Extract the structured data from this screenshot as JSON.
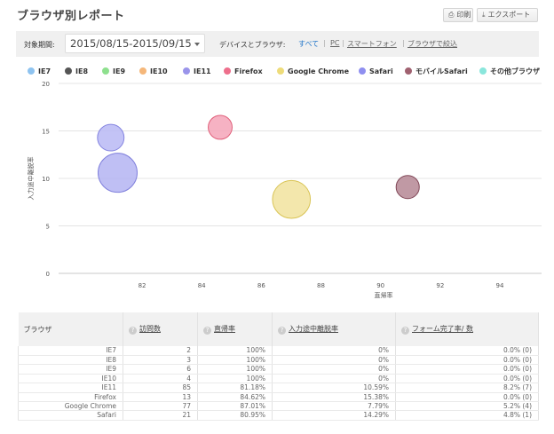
{
  "header": {
    "title": "ブラウザ別レポート",
    "print_label": "印刷",
    "export_label": "エクスポート"
  },
  "filters": {
    "period_label": "対象期間:",
    "period_value": "2015/08/15-2015/09/15",
    "device_label": "デバイスとブラウザ:",
    "devices": [
      "すべて",
      "PC",
      "スマートフォン",
      "ブラウザで絞込"
    ],
    "separator": "|"
  },
  "legend": [
    {
      "name": "IE7",
      "color": "#8ec3f0"
    },
    {
      "name": "IE8",
      "color": "#555555"
    },
    {
      "name": "IE9",
      "color": "#8ee08e"
    },
    {
      "name": "IE10",
      "color": "#f5b77a"
    },
    {
      "name": "IE11",
      "color": "#9a94ea"
    },
    {
      "name": "Firefox",
      "color": "#ee6f8c"
    },
    {
      "name": "Google Chrome",
      "color": "#eedc7a"
    },
    {
      "name": "Safari",
      "color": "#8f8ff0"
    },
    {
      "name": "モバイルSafari",
      "color": "#a06170"
    },
    {
      "name": "その他ブラウザ",
      "color": "#8ae6dc"
    }
  ],
  "chart_data": {
    "type": "scatter",
    "xlabel": "直帰率",
    "ylabel": "入力途中離脱率",
    "xlim": [
      79.2,
      95.4
    ],
    "ylim": [
      0,
      20
    ],
    "xticks": [
      "82",
      "84",
      "86",
      "88",
      "90",
      "92",
      "94"
    ],
    "yticks": [
      "0",
      "5",
      "10",
      "15",
      "20"
    ],
    "grid": true,
    "series": [
      {
        "name": "IE11",
        "x": 81.18,
        "y": 10.59,
        "visits": 85,
        "fill": "#b4b4f2",
        "stroke": "#8080dc"
      },
      {
        "name": "Firefox",
        "x": 84.62,
        "y": 15.38,
        "visits": 13,
        "fill": "#f4a4b8",
        "stroke": "#e0607a"
      },
      {
        "name": "Google Chrome",
        "x": 87.01,
        "y": 7.79,
        "visits": 77,
        "fill": "#f1e39e",
        "stroke": "#d9c455"
      },
      {
        "name": "Safari",
        "x": 80.95,
        "y": 14.29,
        "visits": 21,
        "fill": "#b9b9f4",
        "stroke": "#8484e0"
      },
      {
        "name": "モバイルSafari",
        "x": 90.91,
        "y": 9.09,
        "visits": 11,
        "fill": "#b58794",
        "stroke": "#804656"
      }
    ]
  },
  "table": {
    "headers": [
      "ブラウザ",
      "訪問数",
      "直帰率",
      "入力途中離脱率",
      "フォーム完了率/ 数"
    ],
    "rows": [
      [
        "IE7",
        "2",
        "100%",
        "0%",
        "0.0% (0)"
      ],
      [
        "IE8",
        "3",
        "100%",
        "0%",
        "0.0% (0)"
      ],
      [
        "IE9",
        "6",
        "100%",
        "0%",
        "0.0% (0)"
      ],
      [
        "IE10",
        "4",
        "100%",
        "0%",
        "0.0% (0)"
      ],
      [
        "IE11",
        "85",
        "81.18%",
        "10.59%",
        "8.2% (7)"
      ],
      [
        "Firefox",
        "13",
        "84.62%",
        "15.38%",
        "0.0% (0)"
      ],
      [
        "Google Chrome",
        "77",
        "87.01%",
        "7.79%",
        "5.2% (4)"
      ],
      [
        "Safari",
        "21",
        "80.95%",
        "14.29%",
        "4.8% (1)"
      ]
    ]
  }
}
